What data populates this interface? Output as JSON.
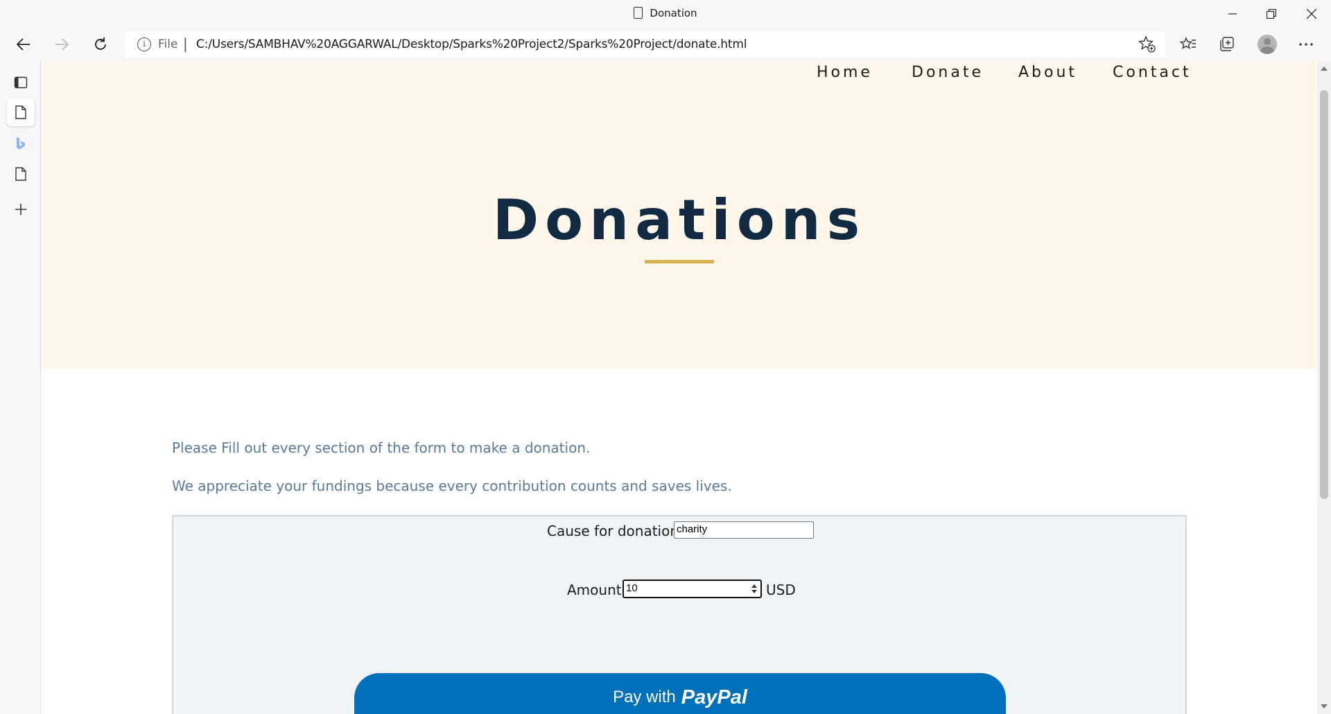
{
  "window": {
    "title": "Donation"
  },
  "addressbar": {
    "scheme": "File",
    "url": "C:/Users/SAMBHAV%20AGGARWAL/Desktop/Sparks%20Project2/Sparks%20Project/donate.html"
  },
  "nav": {
    "home": "Home",
    "donate": "Donate",
    "about": "About",
    "contact": "Contact"
  },
  "hero": {
    "title": "Donations"
  },
  "intro": {
    "line1": "Please Fill out every section of the form to make a donation.",
    "line2": "We appreciate your fundings because every contribution counts and saves lives."
  },
  "form": {
    "cause_label": "Cause for donation",
    "cause_value": "charity",
    "amount_label": "Amount",
    "amount_value": "10",
    "currency": "USD",
    "pay_prefix": "Pay with",
    "pay_brand": "PayPal"
  },
  "colors": {
    "hero_bg": "#fff8ea",
    "title": "#122a42",
    "accent_underline": "#d9b24a",
    "intro_text": "#5b7a99",
    "form_bg": "#f1f4f7",
    "paypal_blue": "#0070ba"
  },
  "icons": {
    "tab": "document-icon",
    "back": "back-arrow-icon",
    "forward": "forward-arrow-icon",
    "reload": "reload-icon",
    "info": "info-icon",
    "add_favorite": "add-favorite-icon",
    "favorites": "favorites-icon",
    "collections": "collections-icon",
    "profile": "profile-avatar-icon",
    "more": "more-icon"
  }
}
